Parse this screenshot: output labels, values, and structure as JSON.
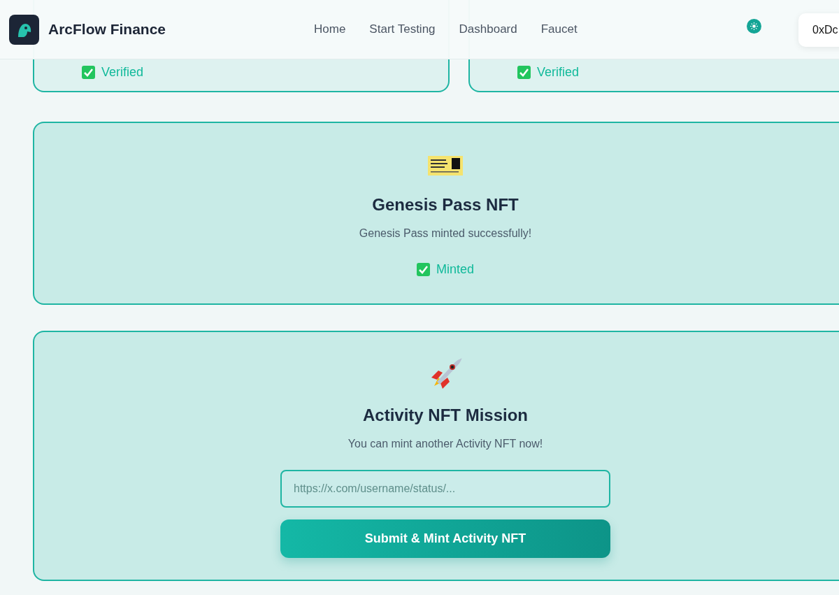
{
  "header": {
    "brand": "ArcFlow Finance",
    "nav": [
      {
        "label": "Home"
      },
      {
        "label": "Start Testing"
      },
      {
        "label": "Dashboard"
      },
      {
        "label": "Faucet"
      }
    ],
    "wallet": "0xDc"
  },
  "top_cards": [
    {
      "status": "Verified"
    },
    {
      "status": "Verified"
    }
  ],
  "genesis": {
    "title": "Genesis Pass NFT",
    "description": "Genesis Pass minted successfully!",
    "status": "Minted"
  },
  "activity": {
    "title": "Activity NFT Mission",
    "description": "You can mint another Activity NFT now!",
    "placeholder": "https://x.com/username/status/...",
    "button": "Submit & Mint Activity NFT"
  }
}
